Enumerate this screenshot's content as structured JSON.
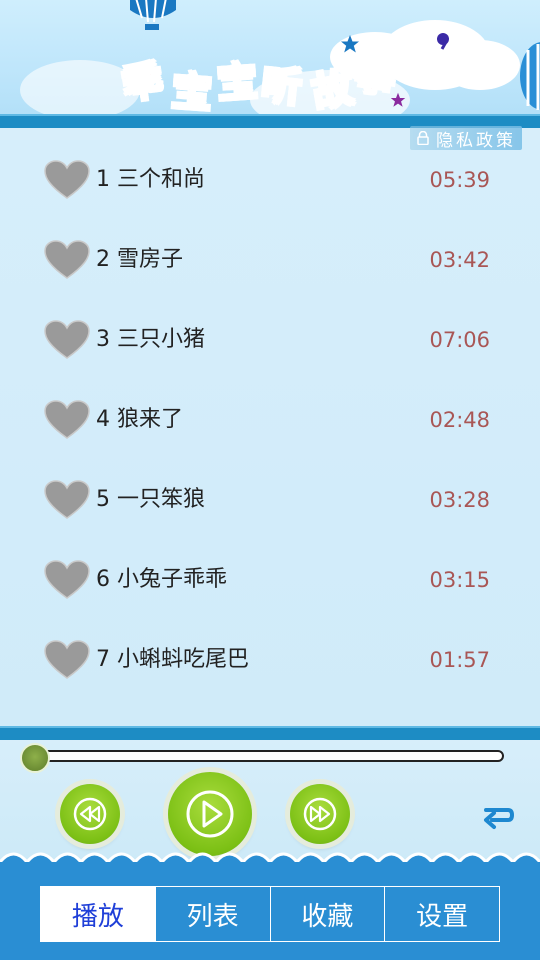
{
  "header": {
    "title_chars": [
      "乖",
      "宝",
      "宝",
      "听",
      "故",
      "事"
    ],
    "title_colors": [
      "#e5232b",
      "#22a43c",
      "#2a7fd6",
      "#f29a18",
      "#2a9ad6",
      "#c21f7a"
    ]
  },
  "privacy": {
    "label": "隐私政策",
    "icon": "lock-icon"
  },
  "stories": [
    {
      "title": "1 三个和尚",
      "duration": "05:39",
      "favorite": false
    },
    {
      "title": "2 雪房子",
      "duration": "03:42",
      "favorite": false
    },
    {
      "title": "3 三只小猪",
      "duration": "07:06",
      "favorite": false
    },
    {
      "title": "4 狼来了",
      "duration": "02:48",
      "favorite": false
    },
    {
      "title": "5 一只笨狼",
      "duration": "03:28",
      "favorite": false
    },
    {
      "title": "6 小兔子乖乖",
      "duration": "03:15",
      "favorite": false
    },
    {
      "title": "7 小蝌蚪吃尾巴",
      "duration": "01:57",
      "favorite": false
    }
  ],
  "player": {
    "progress": 0,
    "controls": [
      "previous-icon",
      "play-icon",
      "next-icon",
      "repeat-icon"
    ]
  },
  "tabs": [
    {
      "label": "播放",
      "active": true
    },
    {
      "label": "列表",
      "active": false
    },
    {
      "label": "收藏",
      "active": false
    },
    {
      "label": "设置",
      "active": false
    }
  ],
  "colors": {
    "accent_blue": "#1d8cc4",
    "tab_bar": "#2a8ed3",
    "active_tab_text": "#1f3fd8",
    "duration_text": "#a95655",
    "play_green": "#7cc015"
  }
}
